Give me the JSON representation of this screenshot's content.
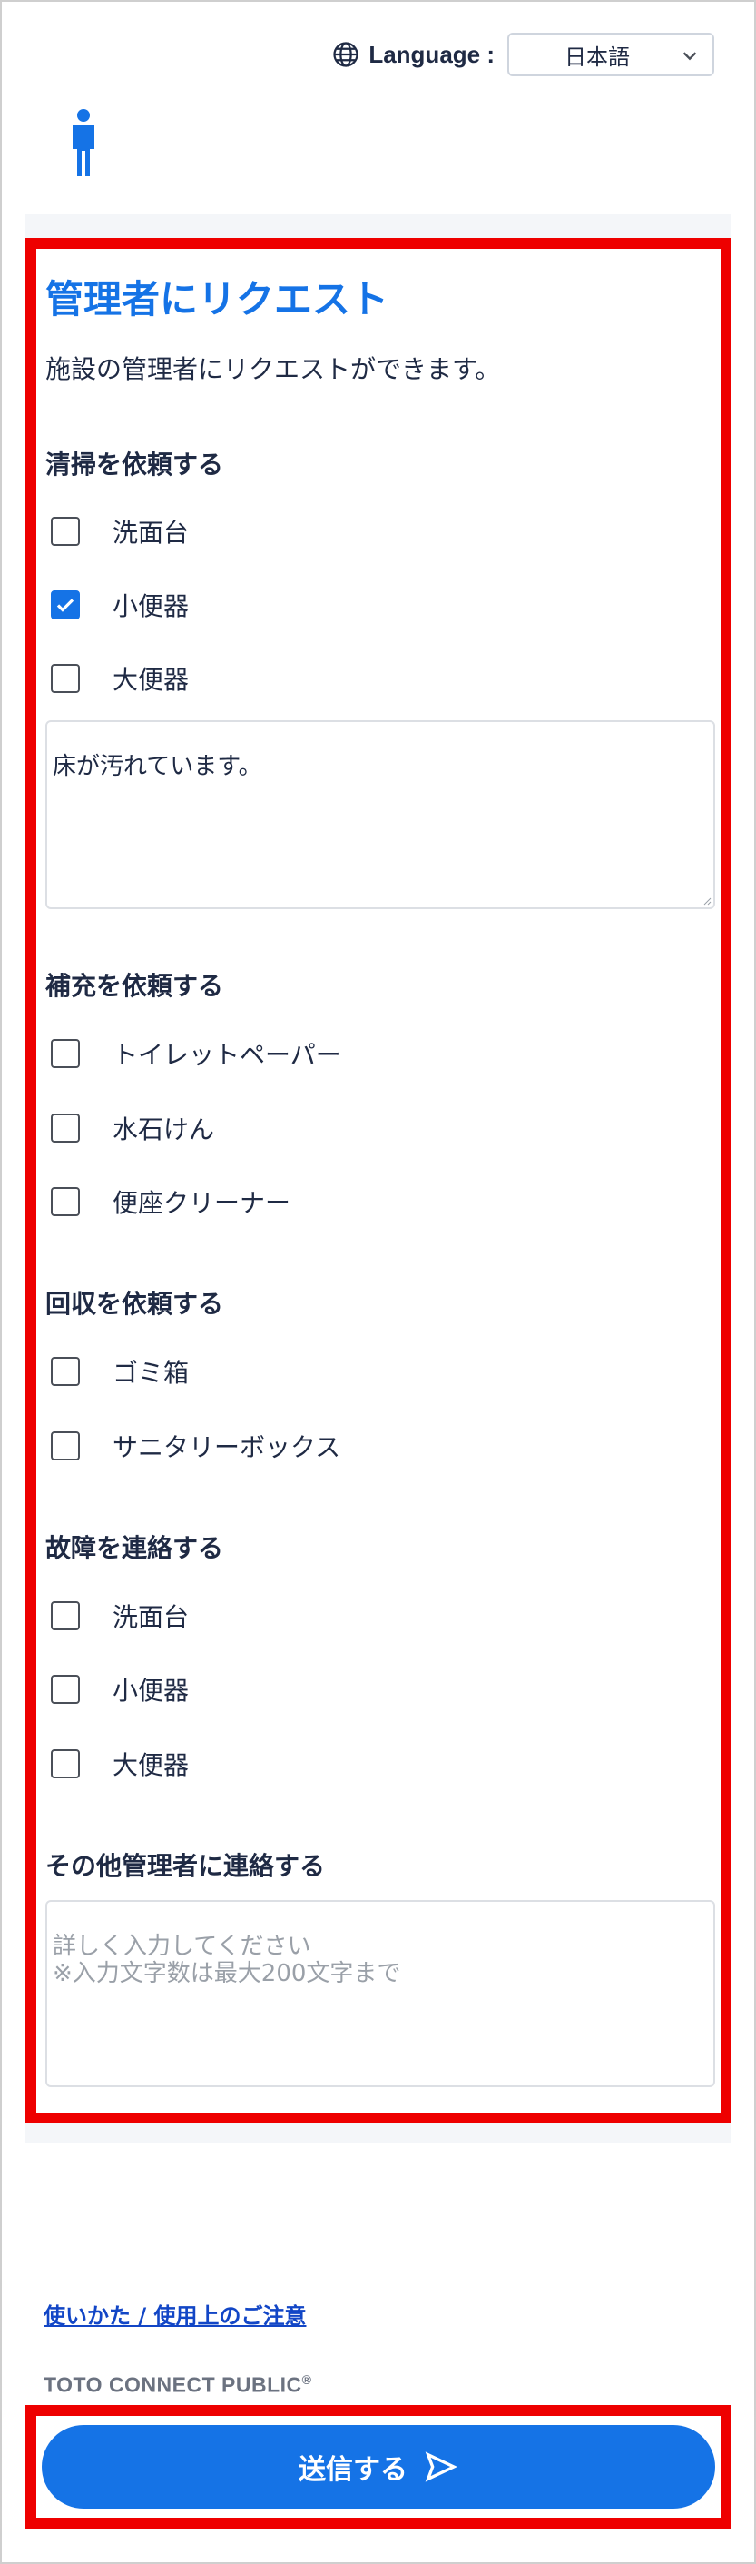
{
  "header": {
    "language_label": "Language :",
    "language_value": "日本語",
    "globe_icon": "globe-icon",
    "chevron_icon": "chevron-down-icon",
    "person_icon": "person-icon"
  },
  "form": {
    "title": "管理者にリクエスト",
    "description": "施設の管理者にリクエストができます。",
    "sections": [
      {
        "title": "清掃を依頼する",
        "options": [
          {
            "label": "洗面台",
            "checked": false
          },
          {
            "label": "小便器",
            "checked": true
          },
          {
            "label": "大便器",
            "checked": false
          }
        ],
        "textarea_value": "床が汚れています。"
      },
      {
        "title": "補充を依頼する",
        "options": [
          {
            "label": "トイレットペーパー",
            "checked": false
          },
          {
            "label": "水石けん",
            "checked": false
          },
          {
            "label": "便座クリーナー",
            "checked": false
          }
        ]
      },
      {
        "title": "回収を依頼する",
        "options": [
          {
            "label": "ゴミ箱",
            "checked": false
          },
          {
            "label": "サニタリーボックス",
            "checked": false
          }
        ]
      },
      {
        "title": "故障を連絡する",
        "options": [
          {
            "label": "洗面台",
            "checked": false
          },
          {
            "label": "小便器",
            "checked": false
          },
          {
            "label": "大便器",
            "checked": false
          }
        ]
      },
      {
        "title": "その他管理者に連絡する",
        "textarea_placeholder": "詳しく入力してください\n※入力文字数は最大200文字まで"
      }
    ]
  },
  "footer": {
    "usage_link": "使いかた / 使用上のご注意",
    "brand": "TOTO CONNECT PUBLIC",
    "brand_mark": "®",
    "submit_label": "送信する",
    "submit_icon": "send-icon"
  },
  "colors": {
    "accent": "#1573e6",
    "highlight_border": "#ee0000",
    "text": "#1f2a44"
  }
}
